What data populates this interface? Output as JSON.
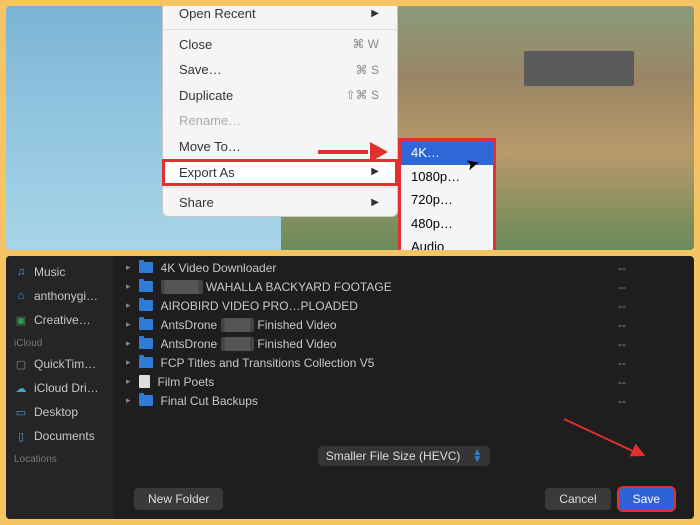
{
  "top_menu": {
    "open_recent": "Open Recent",
    "close": "Close",
    "close_sc": "⌘ W",
    "save": "Save…",
    "save_sc": "⌘ S",
    "duplicate": "Duplicate",
    "duplicate_sc": "⇧⌘ S",
    "rename": "Rename…",
    "move_to": "Move To…",
    "export_as": "Export As",
    "share": "Share"
  },
  "submenu": {
    "k4": "4K…",
    "p1080": "1080p…",
    "p720": "720p…",
    "p480": "480p…",
    "audio": "Audio Only…"
  },
  "sidebar": {
    "music": "Music",
    "user": "anthonygi…",
    "creative": "Creative…",
    "icloud_head": "iCloud",
    "quicktime": "QuickTim…",
    "icloud_drive": "iCloud Dri…",
    "desktop": "Desktop",
    "documents": "Documents",
    "locations_head": "Locations"
  },
  "files": [
    {
      "name": "4K Video Downloader"
    },
    {
      "name": "WAHALLA BACKYARD FOOTAGE",
      "blur_pre": true
    },
    {
      "name": "AIROBIRD VIDEO PRO…PLOADED"
    },
    {
      "name": "AntsDrone",
      "suffix": "Finished Video",
      "blur_mid": true
    },
    {
      "name": "AntsDrone",
      "suffix": "Finished Video",
      "blur_mid": true
    },
    {
      "name": "FCP Titles and Transitions Collection V5"
    },
    {
      "name": "Film Poets",
      "icon": "file"
    },
    {
      "name": "Final Cut Backups"
    }
  ],
  "format_select": "Smaller File Size (HEVC)",
  "buttons": {
    "new_folder": "New Folder",
    "cancel": "Cancel",
    "save": "Save"
  }
}
